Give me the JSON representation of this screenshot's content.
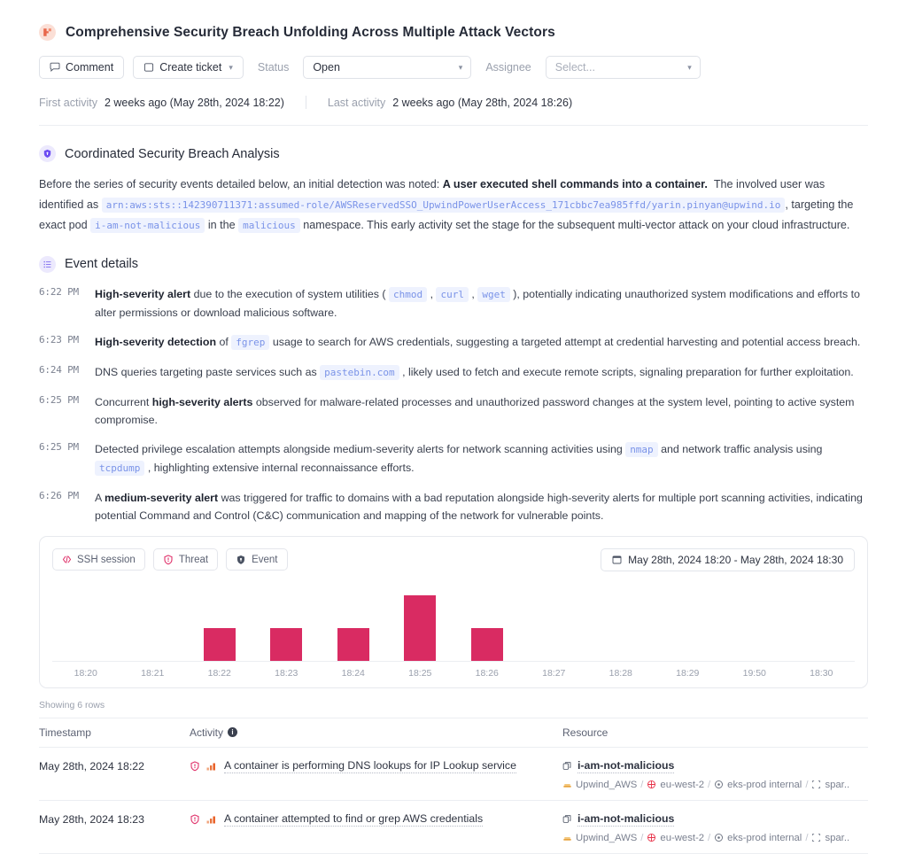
{
  "header": {
    "brand_icon": "upwind-logo-icon",
    "title": "Comprehensive Security Breach Unfolding Across Multiple Attack Vectors",
    "comment_label": "Comment",
    "create_ticket_label": "Create ticket",
    "status_label": "Status",
    "status_value": "Open",
    "assignee_label": "Assignee",
    "assignee_placeholder": "Select...",
    "first_activity_label": "First activity",
    "first_activity_value": "2 weeks ago (May 28th, 2024 18:22)",
    "last_activity_label": "Last activity",
    "last_activity_value": "2 weeks ago (May 28th, 2024 18:26)"
  },
  "analysis": {
    "title": "Coordinated Security Breach Analysis",
    "p1_a": "Before the series of security events detailed below, an initial detection was noted:",
    "p1_bold": "A user executed shell commands into a container.",
    "p1_b": "The involved user was identified as",
    "arn": "arn:aws:sts::142390711371:assumed-role/AWSReservedSSO_UpwindPowerUserAccess_171cbbc7ea985ffd/yarin.pinyan@upwind.io",
    "p1_c": ", targeting the exact pod",
    "pod": "i-am-not-malicious",
    "p1_d": "in the",
    "namespace": "malicious",
    "p1_e": "namespace. This early activity set the stage for the subsequent multi-vector attack on your cloud infrastructure."
  },
  "event_details": {
    "title": "Event details",
    "events": [
      {
        "time": "6:22 PM",
        "parts": [
          {
            "t": "b",
            "v": "High-severity alert"
          },
          {
            "t": "s",
            "v": " due to the execution of system utilities ("
          },
          {
            "t": "c",
            "v": "chmod"
          },
          {
            "t": "s",
            "v": ","
          },
          {
            "t": "c",
            "v": "curl"
          },
          {
            "t": "s",
            "v": ","
          },
          {
            "t": "c",
            "v": "wget"
          },
          {
            "t": "s",
            "v": "), potentially indicating unauthorized system modifications and efforts to alter permissions or download malicious software."
          }
        ]
      },
      {
        "time": "6:23 PM",
        "parts": [
          {
            "t": "b",
            "v": "High-severity detection"
          },
          {
            "t": "s",
            "v": " of"
          },
          {
            "t": "c",
            "v": "fgrep"
          },
          {
            "t": "s",
            "v": "usage to search for AWS credentials, suggesting a targeted attempt at credential harvesting and potential access breach."
          }
        ]
      },
      {
        "time": "6:24 PM",
        "parts": [
          {
            "t": "s",
            "v": "DNS queries targeting paste services such as"
          },
          {
            "t": "c",
            "v": "pastebin.com"
          },
          {
            "t": "s",
            "v": ", likely used to fetch and execute remote scripts, signaling preparation for further exploitation."
          }
        ]
      },
      {
        "time": "6:25 PM",
        "parts": [
          {
            "t": "s",
            "v": "Concurrent "
          },
          {
            "t": "b",
            "v": "high-severity alerts"
          },
          {
            "t": "s",
            "v": " observed for malware-related processes and unauthorized password changes at the system level, pointing to active system compromise."
          }
        ]
      },
      {
        "time": "6:25 PM",
        "parts": [
          {
            "t": "s",
            "v": "Detected privilege escalation attempts alongside medium-severity alerts for network scanning activities using"
          },
          {
            "t": "c",
            "v": "nmap"
          },
          {
            "t": "s",
            "v": "and network traffic analysis using"
          },
          {
            "t": "c",
            "v": "tcpdump"
          },
          {
            "t": "s",
            "v": ", highlighting extensive internal reconnaissance efforts."
          }
        ]
      },
      {
        "time": "6:26 PM",
        "parts": [
          {
            "t": "s",
            "v": "A "
          },
          {
            "t": "b",
            "v": "medium-severity alert"
          },
          {
            "t": "s",
            "v": " was triggered for traffic to domains with a bad reputation alongside high-severity alerts for multiple port scanning activities, indicating potential Command and Control (C&C) communication and mapping of the network for vulnerable points."
          }
        ]
      }
    ]
  },
  "chart_card": {
    "chips": [
      {
        "label": "SSH session",
        "icon": "code-icon",
        "color": "#e0336b"
      },
      {
        "label": "Threat",
        "icon": "threat-shield-icon",
        "color": "#e0336b"
      },
      {
        "label": "Event",
        "icon": "event-shield-icon",
        "color": "#4a5262"
      }
    ],
    "date_range": "May 28th, 2024 18:20 - May 28th, 2024 18:30",
    "calendar_icon": "calendar-icon"
  },
  "chart_data": {
    "type": "bar",
    "title": "",
    "xlabel": "",
    "ylabel": "",
    "categories": [
      "18:20",
      "18:21",
      "18:22",
      "18:23",
      "18:24",
      "18:25",
      "18:26",
      "18:27",
      "18:28",
      "18:29",
      "19:50",
      "18:30"
    ],
    "values": [
      0,
      0,
      1,
      1,
      1,
      2,
      1,
      0,
      0,
      0,
      0,
      0
    ],
    "ylim": [
      0,
      2.2
    ],
    "grid": false,
    "bar_color": "#d92b62",
    "legend": [
      "SSH session",
      "Threat",
      "Event"
    ]
  },
  "table": {
    "showing": "Showing 6 rows",
    "columns": {
      "timestamp": "Timestamp",
      "activity": "Activity",
      "resource": "Resource"
    },
    "rows": [
      {
        "timestamp": "May 28th, 2024 18:22",
        "severity_icon": "threat-shield-icon",
        "signal_icon": "signal-bars-icon",
        "activity": "A container is performing DNS lookups for IP Lookup service",
        "resource_name": "i-am-not-malicious",
        "copy_icon": "copy-icon",
        "path": [
          {
            "icon": "cloud-account-icon",
            "label": "Upwind_AWS"
          },
          {
            "icon": "region-globe-icon",
            "label": "eu-west-2"
          },
          {
            "icon": "cluster-icon",
            "label": "eks-prod internal"
          },
          {
            "icon": "namespace-icon",
            "label": "spar.."
          }
        ]
      },
      {
        "timestamp": "May 28th, 2024 18:23",
        "severity_icon": "threat-shield-icon",
        "signal_icon": "signal-bars-icon",
        "activity": "A container attempted to find or grep AWS credentials",
        "resource_name": "i-am-not-malicious",
        "copy_icon": "copy-icon",
        "path": [
          {
            "icon": "cloud-account-icon",
            "label": "Upwind_AWS"
          },
          {
            "icon": "region-globe-icon",
            "label": "eu-west-2"
          },
          {
            "icon": "cluster-icon",
            "label": "eks-prod internal"
          },
          {
            "icon": "namespace-icon",
            "label": "spar.."
          }
        ]
      }
    ]
  }
}
